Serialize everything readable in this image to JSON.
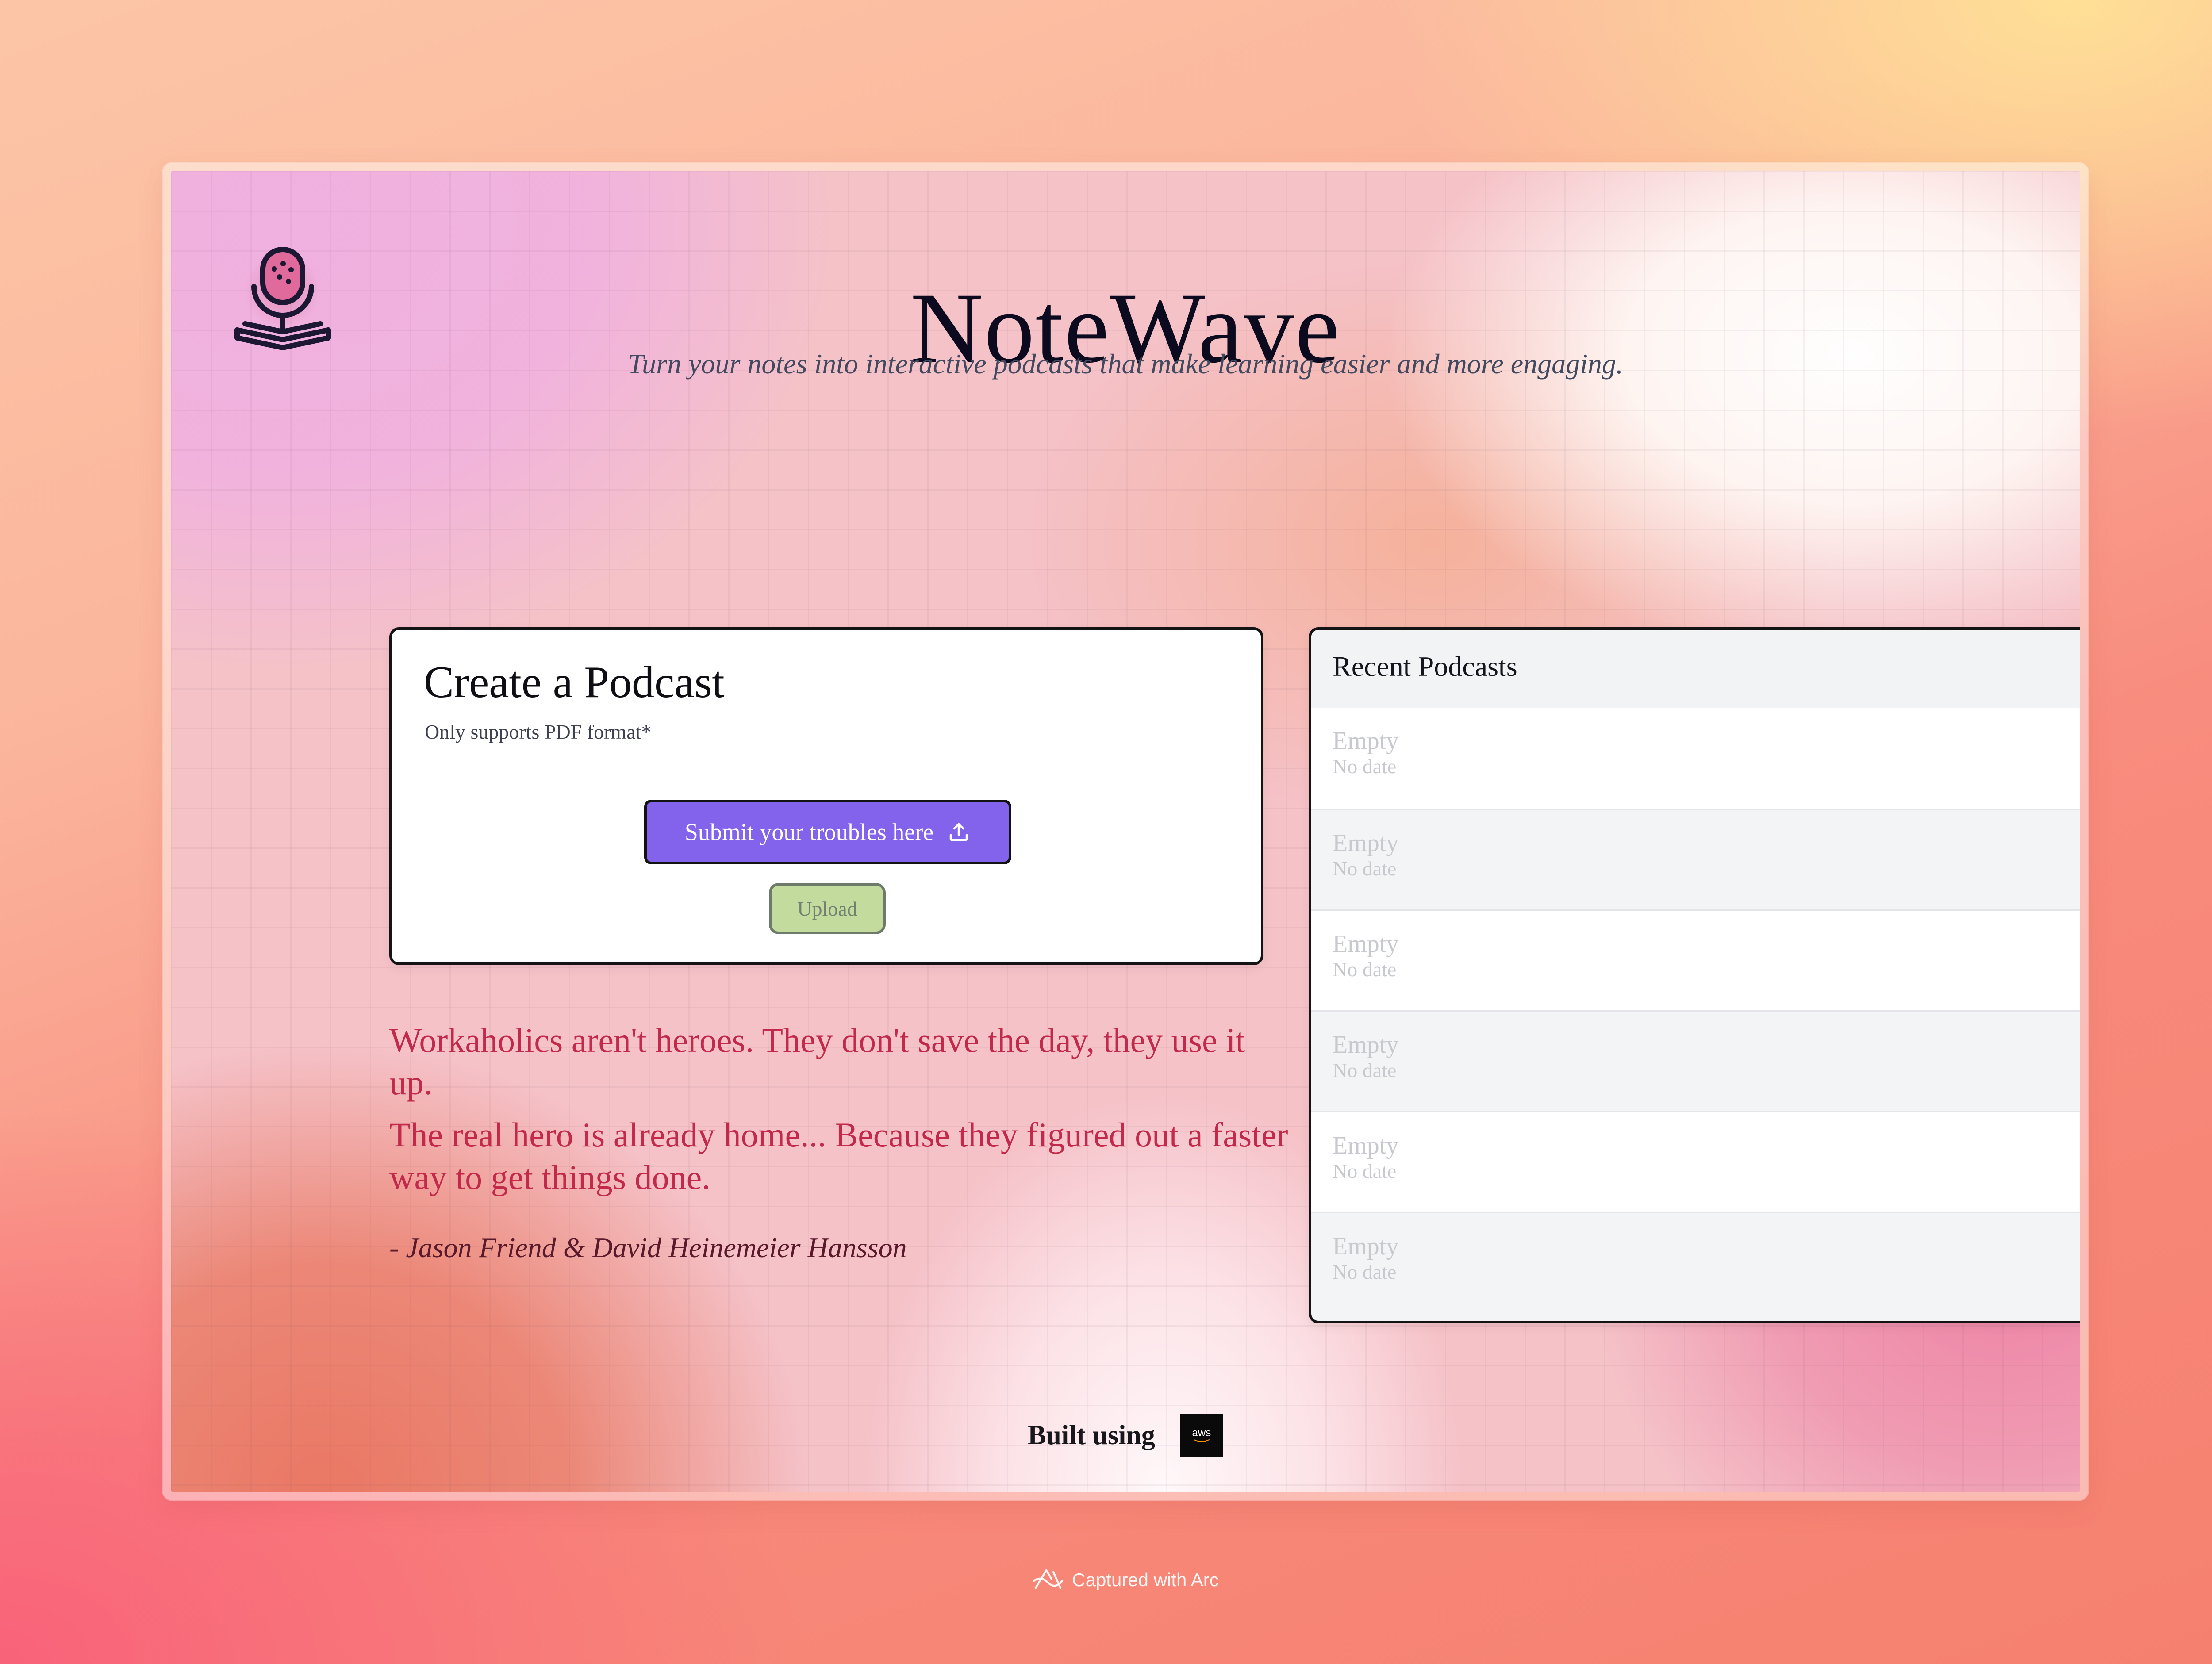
{
  "app": {
    "title": "NoteWave",
    "tagline": "Turn your notes into interactive podcasts that make learning easier and more engaging.",
    "logo_icon": "podcast-microphone-book-icon"
  },
  "create": {
    "title": "Create a Podcast",
    "note": "Only supports PDF format*",
    "submit_label": "Submit your troubles here",
    "submit_icon": "upload-icon",
    "upload_label": "Upload"
  },
  "quote": {
    "lines": [
      "Workaholics aren't heroes. They don't save the day, they use it up.",
      "The real hero is already home... Because they figured out a faster way to get things done."
    ],
    "author": "- Jason Friend & David Heinemeier Hansson"
  },
  "recent": {
    "title": "Recent Podcasts",
    "items": [
      {
        "title": "Empty",
        "date": "No date"
      },
      {
        "title": "Empty",
        "date": "No date"
      },
      {
        "title": "Empty",
        "date": "No date"
      },
      {
        "title": "Empty",
        "date": "No date"
      },
      {
        "title": "Empty",
        "date": "No date"
      },
      {
        "title": "Empty",
        "date": "No date"
      }
    ]
  },
  "footer": {
    "built_using": "Built using",
    "logo_text": "aws",
    "logo_icon": "aws-logo-icon"
  },
  "capture": {
    "text": "Captured with Arc",
    "icon": "arc-logo-icon"
  },
  "colors": {
    "primary_button": "#8463ec",
    "upload_button": "#c3dc9e",
    "quote_text": "#c2294a",
    "title_text": "#0c0a1e"
  }
}
